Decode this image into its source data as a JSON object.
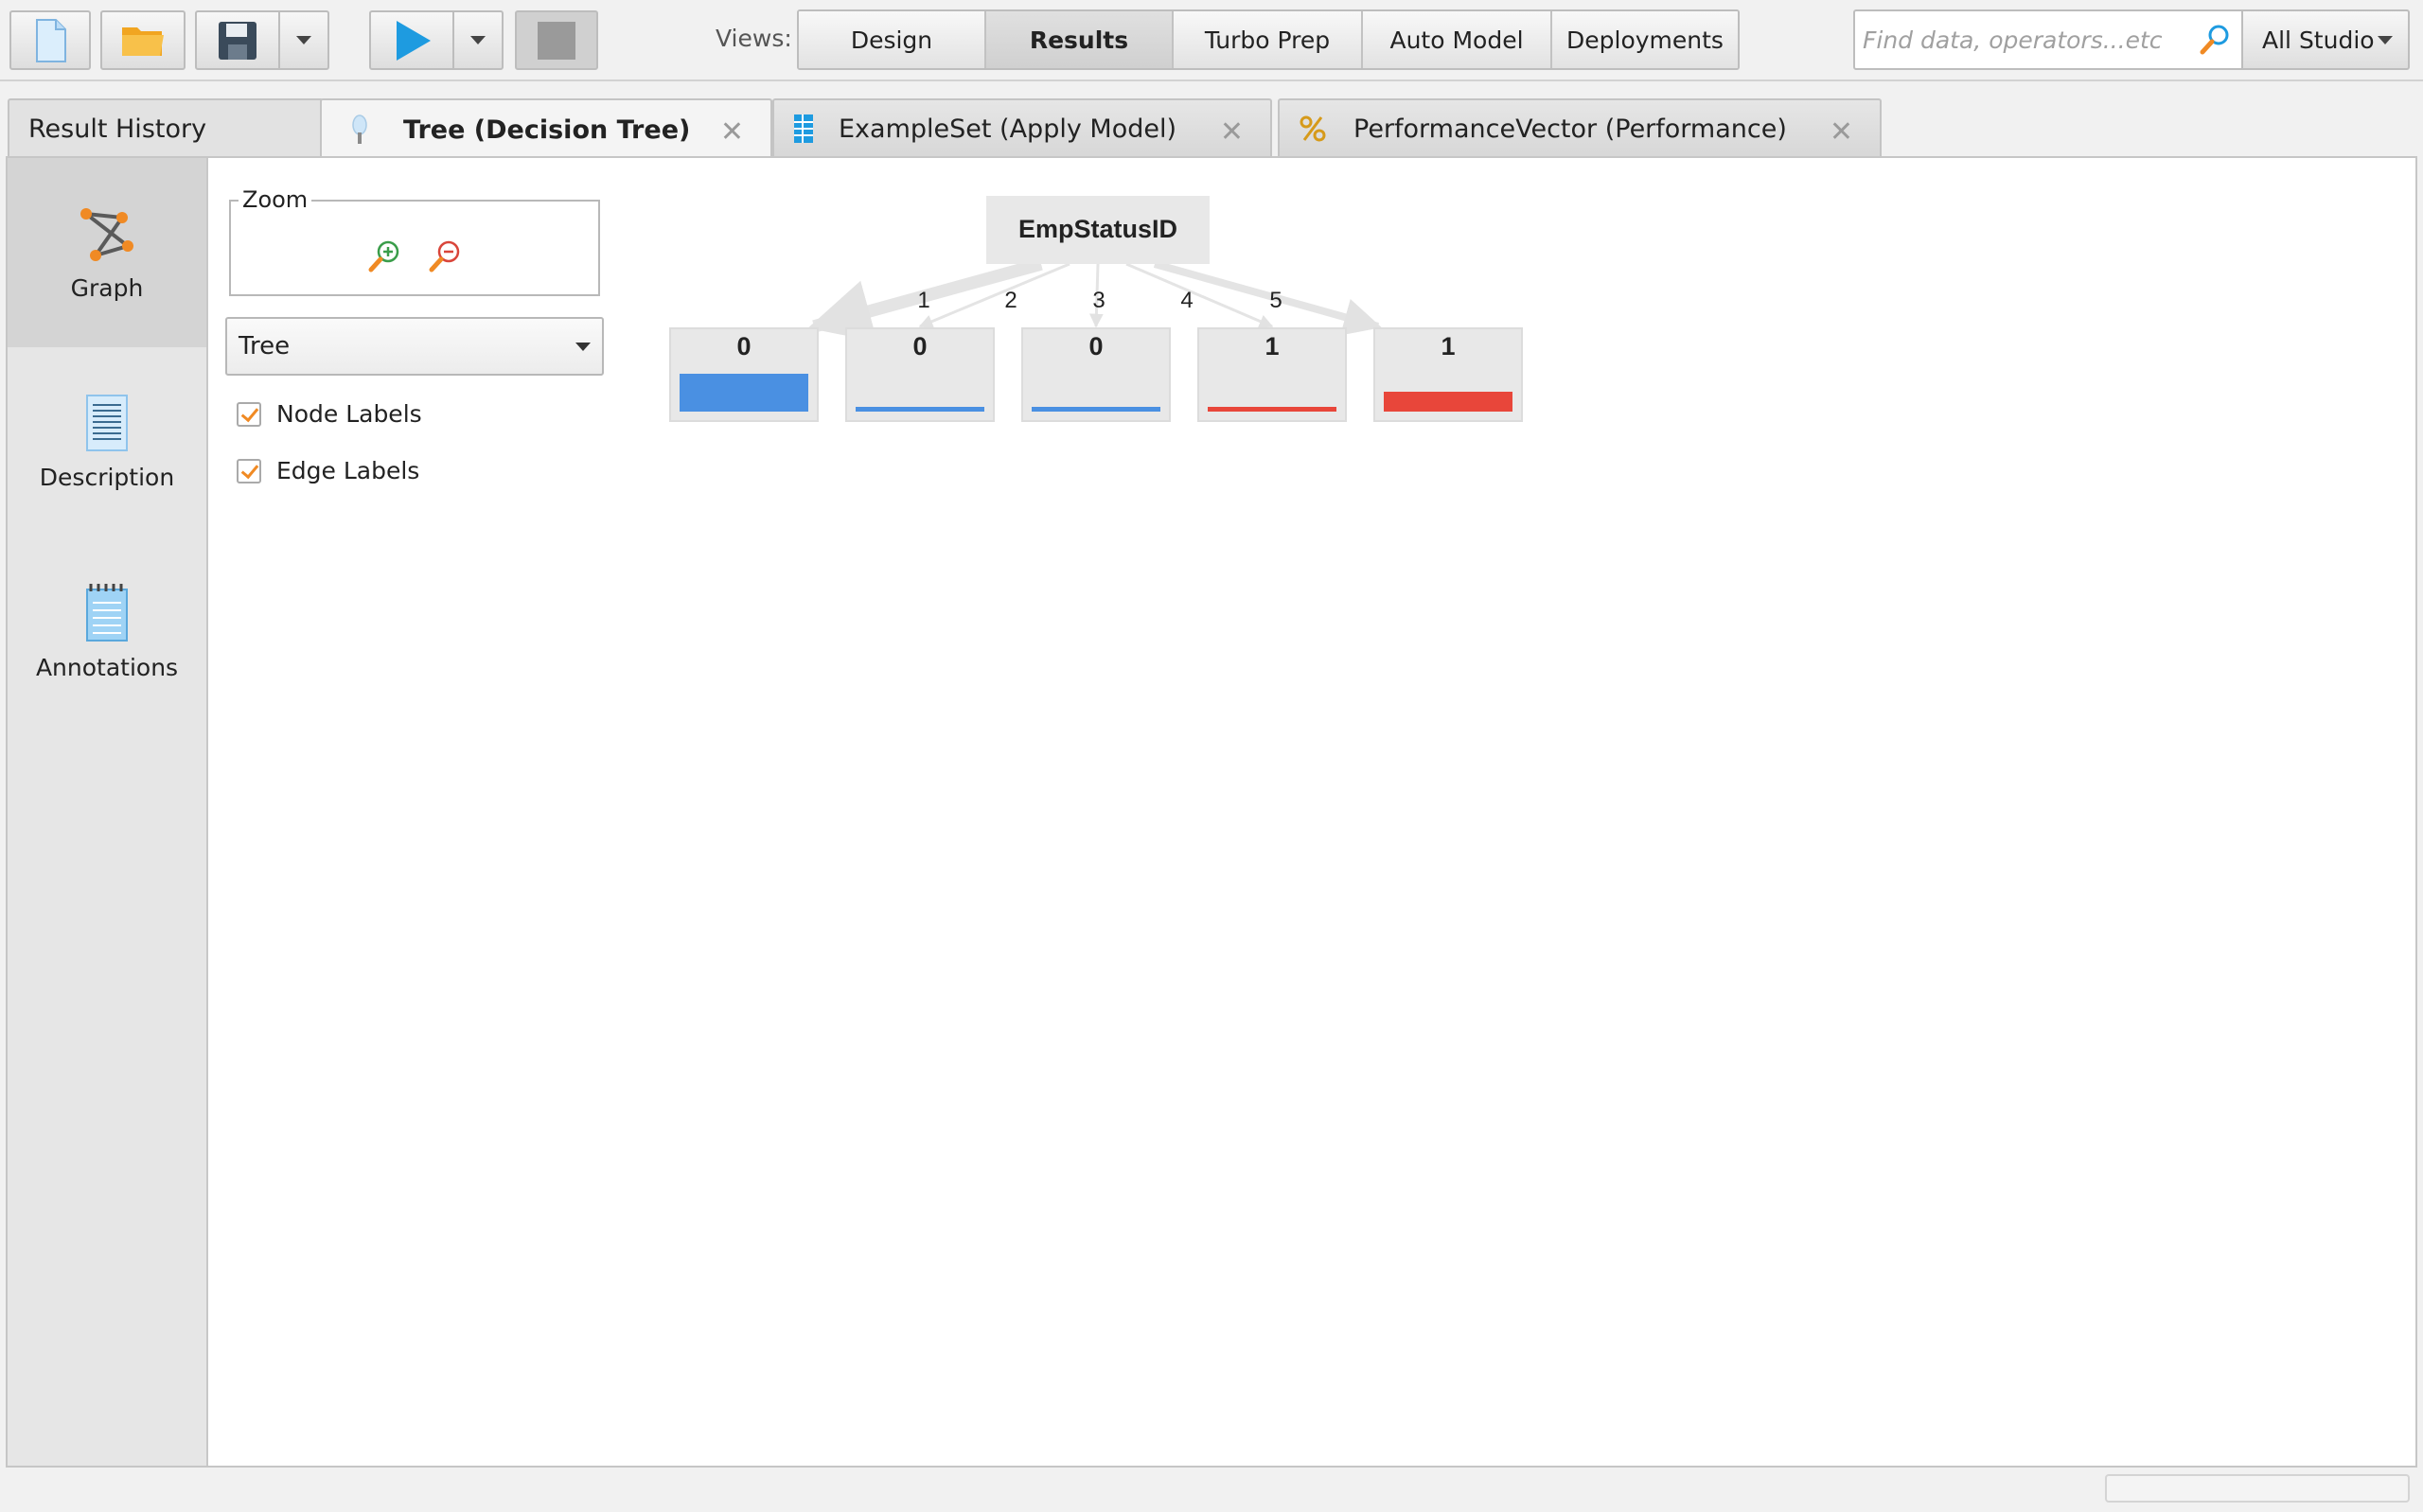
{
  "toolbar": {
    "views_label": "Views:",
    "views": [
      "Design",
      "Results",
      "Turbo Prep",
      "Auto Model",
      "Deployments"
    ],
    "active_view": "Results",
    "search_placeholder": "Find data, operators...etc",
    "scope": "All Studio"
  },
  "tabs": [
    {
      "label": "Result History"
    },
    {
      "label": "Tree (Decision Tree)",
      "icon": "tree-icon"
    },
    {
      "label": "ExampleSet (Apply Model)",
      "icon": "table-icon"
    },
    {
      "label": "PerformanceVector (Performance)",
      "icon": "percent-icon"
    }
  ],
  "sidebar": {
    "items": [
      {
        "label": "Graph",
        "icon": "graph-icon"
      },
      {
        "label": "Description",
        "icon": "description-icon"
      },
      {
        "label": "Annotations",
        "icon": "annotations-icon"
      }
    ]
  },
  "controls": {
    "zoom_label": "Zoom",
    "layout_selected": "Tree",
    "node_labels": "Node Labels",
    "edge_labels": "Edge Labels"
  },
  "tree": {
    "root": "EmpStatusID",
    "leaves": [
      {
        "edge": "1",
        "label": "0",
        "class_color": "#4a90e2",
        "fill_fraction": 0.95
      },
      {
        "edge": "2",
        "label": "0",
        "class_color": "#4a90e2",
        "fill_fraction": 0.08
      },
      {
        "edge": "3",
        "label": "0",
        "class_color": "#4a90e2",
        "fill_fraction": 0.08
      },
      {
        "edge": "4",
        "label": "1",
        "class_color": "#e8463a",
        "fill_fraction": 0.08
      },
      {
        "edge": "5",
        "label": "1",
        "class_color": "#e8463a",
        "fill_fraction": 0.5
      }
    ]
  }
}
